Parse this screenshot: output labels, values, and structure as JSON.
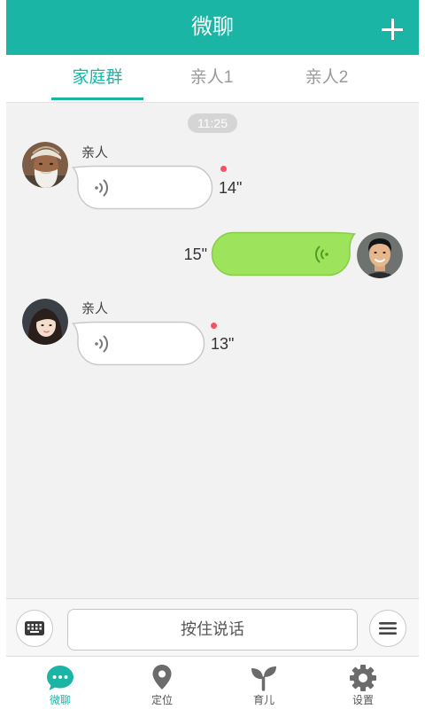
{
  "header": {
    "title": "微聊",
    "add_icon": "plus-icon"
  },
  "tabs": [
    {
      "label": "家庭群",
      "active": true
    },
    {
      "label": "亲人1",
      "active": false
    },
    {
      "label": "亲人2",
      "active": false
    }
  ],
  "chat": {
    "timestamp": "11:25",
    "messages": [
      {
        "outgoing": false,
        "sender": "亲人",
        "voice_icon": "voice-wave-icon",
        "duration": "14\"",
        "unread": true
      },
      {
        "outgoing": true,
        "voice_icon": "voice-wave-icon",
        "duration": "15\"",
        "unread": false
      },
      {
        "outgoing": false,
        "sender": "亲人",
        "voice_icon": "voice-wave-icon",
        "duration": "13\"",
        "unread": true
      }
    ]
  },
  "input_bar": {
    "keyboard_icon": "keyboard-icon",
    "hold_to_talk_label": "按住说话",
    "menu_icon": "menu-icon"
  },
  "bottom_nav": [
    {
      "label": "微聊",
      "icon": "chat-bubble-icon",
      "active": true
    },
    {
      "label": "定位",
      "icon": "location-pin-icon",
      "active": false
    },
    {
      "label": "育儿",
      "icon": "sprout-icon",
      "active": false
    },
    {
      "label": "设置",
      "icon": "gear-icon",
      "active": false
    }
  ],
  "colors": {
    "accent": "#1bb5a6",
    "outgoing_bubble": "#9de35b",
    "unread_dot": "#f4525f",
    "chat_background": "#f2f2f2"
  }
}
